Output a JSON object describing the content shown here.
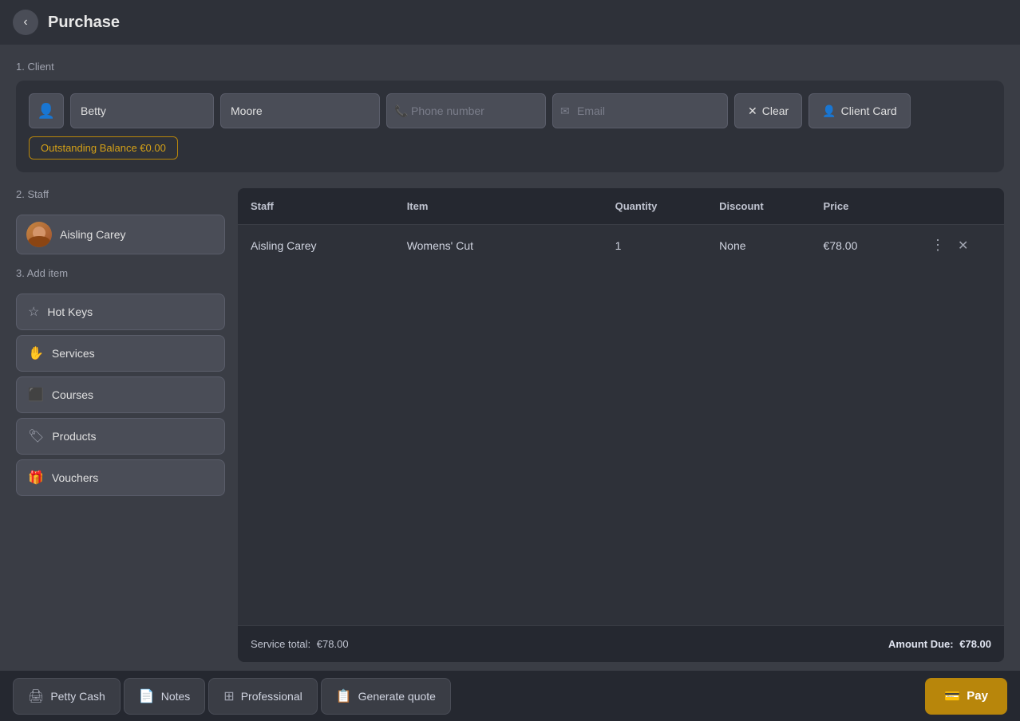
{
  "header": {
    "back_label": "‹",
    "title": "Purchase"
  },
  "client_section": {
    "label": "1. Client",
    "first_name": "Betty",
    "last_name": "Moore",
    "phone_placeholder": "Phone number",
    "email_placeholder": "Email",
    "clear_label": "Clear",
    "client_card_label": "Client Card",
    "outstanding_label": "Outstanding Balance €0.00"
  },
  "staff_section": {
    "label": "2. Staff",
    "staff_name": "Aisling Carey"
  },
  "add_item_section": {
    "label": "3. Add item",
    "buttons": [
      {
        "id": "hot-keys",
        "icon": "★",
        "label": "Hot Keys"
      },
      {
        "id": "services",
        "icon": "✋",
        "label": "Services"
      },
      {
        "id": "courses",
        "icon": "🎓",
        "label": "Courses"
      },
      {
        "id": "products",
        "icon": "🏷",
        "label": "Products"
      },
      {
        "id": "vouchers",
        "icon": "🎁",
        "label": "Vouchers"
      }
    ]
  },
  "table": {
    "columns": [
      "Staff",
      "Item",
      "Quantity",
      "Discount",
      "Price",
      ""
    ],
    "rows": [
      {
        "staff": "Aisling Carey",
        "item": "Womens' Cut",
        "quantity": "1",
        "discount": "None",
        "price": "€78.00"
      }
    ],
    "service_total_label": "Service total:",
    "service_total_value": "€78.00",
    "amount_due_label": "Amount Due:",
    "amount_due_value": "€78.00"
  },
  "bottom_bar": {
    "buttons": [
      {
        "id": "petty-cash",
        "icon": "🖨",
        "label": "Petty Cash"
      },
      {
        "id": "notes",
        "icon": "📄",
        "label": "Notes"
      },
      {
        "id": "professional",
        "icon": "⊞",
        "label": "Professional"
      },
      {
        "id": "generate-quote",
        "icon": "📋",
        "label": "Generate quote"
      }
    ],
    "pay_label": "Pay",
    "pay_icon": "💳"
  }
}
